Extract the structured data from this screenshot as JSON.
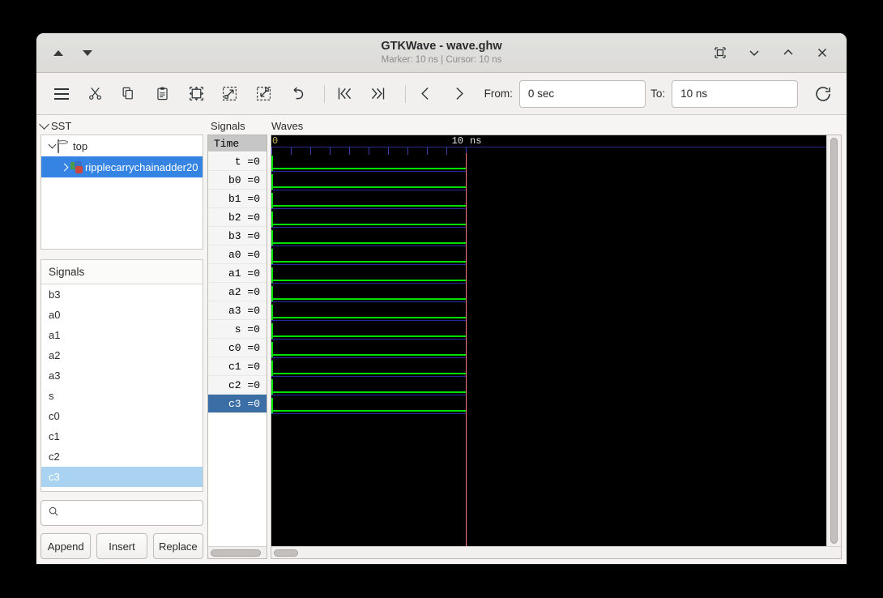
{
  "window": {
    "title": "GTKWave - wave.ghw",
    "subtitle": "Marker: 10 ns  |  Cursor: 10 ns",
    "nav_prev_icon": "triangle-up-icon",
    "nav_next_icon": "triangle-down-icon",
    "controls": {
      "restore_icon": "restore-window-icon",
      "minimize_icon": "chevron-down-icon",
      "maximize_icon": "chevron-up-icon",
      "close_icon": "close-icon"
    }
  },
  "toolbar": {
    "buttons": [
      {
        "name": "menu-button",
        "icon": "hamburger-menu-icon",
        "label": "Menu"
      },
      {
        "name": "cut-button",
        "icon": "scissors-icon",
        "label": "Cut"
      },
      {
        "name": "copy-button",
        "icon": "copy-icon",
        "label": "Copy"
      },
      {
        "name": "paste-button",
        "icon": "clipboard-icon",
        "label": "Paste"
      },
      {
        "name": "zoom-fit-button",
        "icon": "zoom-fit-icon",
        "label": "Zoom Fit"
      },
      {
        "name": "zoom-in-button",
        "icon": "zoom-in-icon",
        "label": "Zoom In"
      },
      {
        "name": "zoom-out-button",
        "icon": "zoom-out-icon",
        "label": "Zoom Out"
      },
      {
        "name": "undo-button",
        "icon": "undo-icon",
        "label": "Undo"
      },
      {
        "name": "goto-start-button",
        "icon": "skip-to-start-icon",
        "label": "Go to Start"
      },
      {
        "name": "goto-end-button",
        "icon": "skip-to-end-icon",
        "label": "Go to End"
      },
      {
        "name": "prev-edge-button",
        "icon": "chevron-left-icon",
        "label": "Previous"
      },
      {
        "name": "next-edge-button",
        "icon": "chevron-right-icon",
        "label": "Next"
      }
    ],
    "from_label": "From:",
    "from_value": "0 sec",
    "to_label": "To:",
    "to_value": "10 ns",
    "reload_icon": "reload-icon"
  },
  "sst": {
    "frame_label": "SST",
    "tree": [
      {
        "label": "top",
        "icon": "module-icon",
        "expanded": true,
        "selected": false,
        "depth": 0
      },
      {
        "label": "ripplecarrychainadder20",
        "icon": "instance-icon",
        "expanded": false,
        "selected": true,
        "depth": 1
      }
    ]
  },
  "signal_list": {
    "header": "Signals",
    "items": [
      {
        "label": "b3",
        "selected": false
      },
      {
        "label": "a0",
        "selected": false
      },
      {
        "label": "a1",
        "selected": false
      },
      {
        "label": "a2",
        "selected": false
      },
      {
        "label": "a3",
        "selected": false
      },
      {
        "label": "s",
        "selected": false
      },
      {
        "label": "c0",
        "selected": false
      },
      {
        "label": "c1",
        "selected": false
      },
      {
        "label": "c2",
        "selected": false
      },
      {
        "label": "c3",
        "selected": true
      }
    ],
    "search_placeholder": "",
    "search_value": "",
    "search_icon": "search-icon",
    "buttons": [
      {
        "name": "append-button",
        "label": "Append"
      },
      {
        "name": "insert-button",
        "label": "Insert"
      },
      {
        "name": "replace-button",
        "label": "Replace"
      }
    ]
  },
  "wave_panel": {
    "signals_frame_label": "Signals",
    "waves_frame_label": "Waves",
    "time_header": "Time",
    "rows": [
      {
        "label": "t =0",
        "selected": false
      },
      {
        "label": "b0 =0",
        "selected": false
      },
      {
        "label": "b1 =0",
        "selected": false
      },
      {
        "label": "b2 =0",
        "selected": false
      },
      {
        "label": "b3 =0",
        "selected": false
      },
      {
        "label": "a0 =0",
        "selected": false
      },
      {
        "label": "a1 =0",
        "selected": false
      },
      {
        "label": "a2 =0",
        "selected": false
      },
      {
        "label": "a3 =0",
        "selected": false
      },
      {
        "label": "s =0",
        "selected": false
      },
      {
        "label": "c0 =0",
        "selected": false
      },
      {
        "label": "c1 =0",
        "selected": false
      },
      {
        "label": "c2 =0",
        "selected": false
      },
      {
        "label": "c3 =0",
        "selected": true
      }
    ],
    "timebar": {
      "start_label": "0",
      "end_label": "10",
      "unit_label": "ns",
      "tick_count": 11
    },
    "cursor": {
      "position_label": "10 ns",
      "color": "#ff7a7a"
    },
    "colors": {
      "background": "#000000",
      "signal_low": "#00e000",
      "row_separator": "#2828a0",
      "tick": "#3f3fb0",
      "start_time_text": "#c8b560"
    }
  },
  "theme": {
    "selection_blue": "#3584e4",
    "list_selection_blue": "#aad3f2",
    "wave_selection_blue": "#3a6ea5"
  }
}
